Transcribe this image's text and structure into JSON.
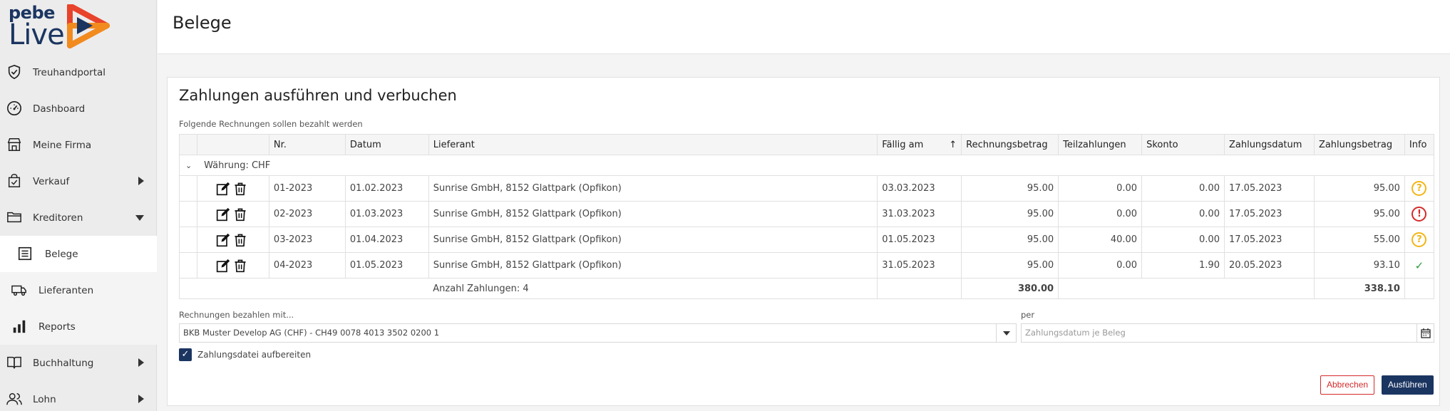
{
  "brand": {
    "name_top": "pebe",
    "name_bottom": "Live"
  },
  "header": {
    "title": "Belege"
  },
  "sidebar": {
    "items": [
      {
        "label": "Treuhandportal",
        "icon": "shield-check-icon"
      },
      {
        "label": "Dashboard",
        "icon": "gauge-icon"
      },
      {
        "label": "Meine Firma",
        "icon": "store-icon"
      },
      {
        "label": "Verkauf",
        "icon": "shopping-bag-icon"
      },
      {
        "label": "Kreditoren",
        "icon": "folder-icon"
      },
      {
        "label": "Belege",
        "icon": "document-list-icon"
      },
      {
        "label": "Lieferanten",
        "icon": "truck-icon"
      },
      {
        "label": "Reports",
        "icon": "bar-chart-icon"
      },
      {
        "label": "Buchhaltung",
        "icon": "book-icon"
      },
      {
        "label": "Lohn",
        "icon": "users-icon"
      }
    ]
  },
  "card": {
    "title": "Zahlungen ausführen und verbuchen",
    "subtitle": "Folgende Rechnungen sollen bezahlt werden"
  },
  "table": {
    "columns": [
      "Nr.",
      "Datum",
      "Lieferant",
      "Fällig am",
      "Rechnungsbetrag",
      "Teilzahlungen",
      "Skonto",
      "Zahlungsdatum",
      "Zahlungsbetrag",
      "Info"
    ],
    "sort_indicator": "↑",
    "group_label": "Währung: CHF",
    "rows": [
      {
        "nr": "01-2023",
        "datum": "01.02.2023",
        "lieferant": "Sunrise GmbH, 8152 Glattpark (Opfikon)",
        "faellig": "03.03.2023",
        "betrag": "95.00",
        "teil": "0.00",
        "skonto": "0.00",
        "zdatum": "17.05.2023",
        "zbetrag": "95.00",
        "info": "?"
      },
      {
        "nr": "02-2023",
        "datum": "01.03.2023",
        "lieferant": "Sunrise GmbH, 8152 Glattpark (Opfikon)",
        "faellig": "31.03.2023",
        "betrag": "95.00",
        "teil": "0.00",
        "skonto": "0.00",
        "zdatum": "17.05.2023",
        "zbetrag": "95.00",
        "info": "!"
      },
      {
        "nr": "03-2023",
        "datum": "01.04.2023",
        "lieferant": "Sunrise GmbH, 8152 Glattpark (Opfikon)",
        "faellig": "01.05.2023",
        "betrag": "95.00",
        "teil": "40.00",
        "skonto": "0.00",
        "zdatum": "17.05.2023",
        "zbetrag": "55.00",
        "info": "?"
      },
      {
        "nr": "04-2023",
        "datum": "01.05.2023",
        "lieferant": "Sunrise GmbH, 8152 Glattpark (Opfikon)",
        "faellig": "31.05.2023",
        "betrag": "95.00",
        "teil": "0.00",
        "skonto": "1.90",
        "zdatum": "20.05.2023",
        "zbetrag": "93.10",
        "info": "✓"
      }
    ],
    "summary": {
      "label": "Anzahl Zahlungen: 4",
      "total_betrag": "380.00",
      "total_zbetrag": "338.10"
    }
  },
  "form": {
    "pay_with_label": "Rechnungen bezahlen mit...",
    "pay_with_value": "BKB Muster Develop AG (CHF) - CH49 0078 4013 3502 0200 1",
    "per_label": "per",
    "per_placeholder": "Zahlungsdatum je Beleg",
    "checkbox_label": "Zahlungsdatei aufbereiten",
    "cancel_label": "Abbrechen",
    "run_label": "Ausführen"
  },
  "colors": {
    "brand": "#1b3561",
    "warn": "#f2b514",
    "error": "#d42a2a",
    "ok": "#2d9b3f"
  }
}
